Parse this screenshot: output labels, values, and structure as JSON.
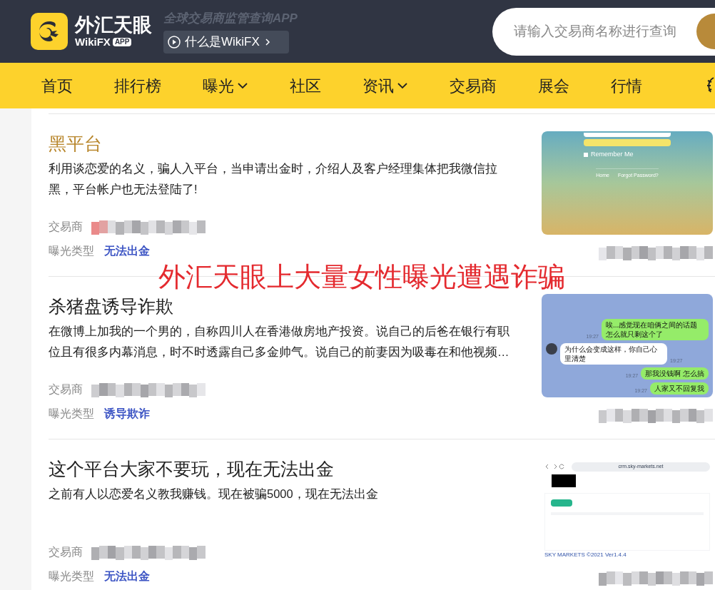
{
  "header": {
    "brand_cn": "外汇天眼",
    "brand_en": "WikiFX",
    "brand_badge": "APP",
    "tagline": "全球交易商监管查询APP",
    "about_button": "什么是WikiFX",
    "search": {
      "placeholder": "请输入交易商名称进行查询"
    }
  },
  "nav": [
    {
      "label": "首页",
      "dropdown": false
    },
    {
      "label": "排行榜",
      "dropdown": false
    },
    {
      "label": "曝光",
      "dropdown": true
    },
    {
      "label": "社区",
      "dropdown": false
    },
    {
      "label": "资讯",
      "dropdown": true
    },
    {
      "label": "交易商",
      "dropdown": false
    },
    {
      "label": "展会",
      "dropdown": false
    },
    {
      "label": "行情",
      "dropdown": false
    }
  ],
  "overlay_caption": "外汇天眼上大量女性曝光遭遇诈骗",
  "posts": [
    {
      "title": "黑平台",
      "highlighted": true,
      "description": "利用谈恋爱的名义，骗人入平台，当申请出金时，介绍人及客户经理集体把我微信拉黑，平台帐户也无法登陆了!",
      "trader_label": "交易商",
      "type_label": "曝光类型",
      "type": "无法出金",
      "thumbnail": {
        "kind": "login",
        "remember": "Remember Me",
        "links": [
          "Home",
          "Forgot Password?"
        ]
      }
    },
    {
      "title": "杀猪盘诱导诈欺",
      "highlighted": false,
      "description": "在微博上加我的一个男的，自称四川人在香港做房地产投资。说自己的后爸在银行有职位且有很多内幕消息，时不时透露自己多金帅气。说自己的前妻因为吸毒在和他视频…",
      "trader_label": "交易商",
      "type_label": "曝光类型",
      "type": "诱导欺诈",
      "thumbnail": {
        "kind": "chat",
        "messages": [
          {
            "text": "唉...感觉现在咱俩之间的话题怎么就只剩这个了",
            "time": "19:27",
            "mine": true
          },
          {
            "text": "为什么会变成这样，你自己心里清楚",
            "time": "19:27",
            "mine": false
          },
          {
            "text": "那我没钱啊 怎么搞",
            "time": "19:27",
            "mine": true
          },
          {
            "text": "人家又不回复我",
            "time": "19:27",
            "mine": true
          }
        ]
      }
    },
    {
      "title": "这个平台大家不要玩，现在无法出金",
      "highlighted": false,
      "description": "之前有人以恋爱名义教我赚钱。现在被骗5000，现在无法出金",
      "trader_label": "交易商",
      "type_label": "曝光类型",
      "type": "无法出金",
      "thumbnail": {
        "kind": "browser",
        "url": "crm.sky-markets.net",
        "footer": "SKY MARKETS ©2021 Ver1.4.4"
      }
    }
  ]
}
